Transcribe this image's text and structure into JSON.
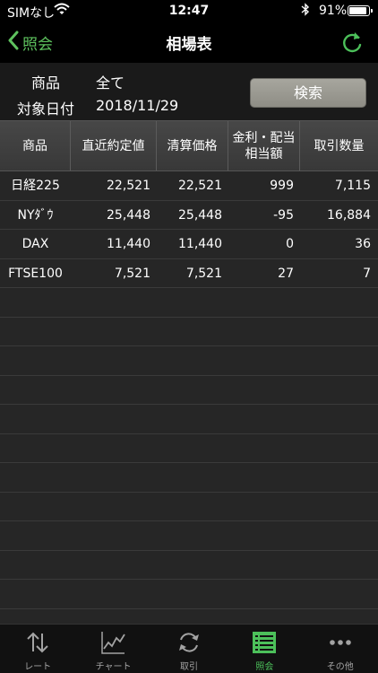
{
  "status_bar": {
    "carrier": "SIMなし",
    "time": "12:47",
    "battery_percent": "91%",
    "battery_level": 0.91
  },
  "nav": {
    "back_label": "照会",
    "title": "相場表"
  },
  "filter": {
    "product_label": "商品",
    "product_value": "全て",
    "date_label": "対象日付",
    "date_value": "2018/11/29",
    "search_label": "検索"
  },
  "table": {
    "headers": [
      "商品",
      "直近約定値",
      "清算価格",
      "金利・配当\n相当額",
      "取引数量"
    ],
    "rows": [
      {
        "name": "日経225",
        "last": "22,521",
        "settle": "22,521",
        "interest": "999",
        "volume": "7,115"
      },
      {
        "name": "NYﾀﾞｳ",
        "last": "25,448",
        "settle": "25,448",
        "interest": "-95",
        "volume": "16,884"
      },
      {
        "name": "DAX",
        "last": "11,440",
        "settle": "11,440",
        "interest": "0",
        "volume": "36"
      },
      {
        "name": "FTSE100",
        "last": "7,521",
        "settle": "7,521",
        "interest": "27",
        "volume": "7"
      }
    ]
  },
  "tabs": [
    {
      "label": "レート",
      "icon": "arrows-updown-icon"
    },
    {
      "label": "チャート",
      "icon": "line-chart-icon"
    },
    {
      "label": "取引",
      "icon": "refresh-icon"
    },
    {
      "label": "照会",
      "icon": "list-icon",
      "active": true
    },
    {
      "label": "その他",
      "icon": "more-icon"
    }
  ],
  "colors": {
    "accent": "#4cc05a",
    "negative": "#e0271d",
    "background": "#1c1c1c"
  }
}
